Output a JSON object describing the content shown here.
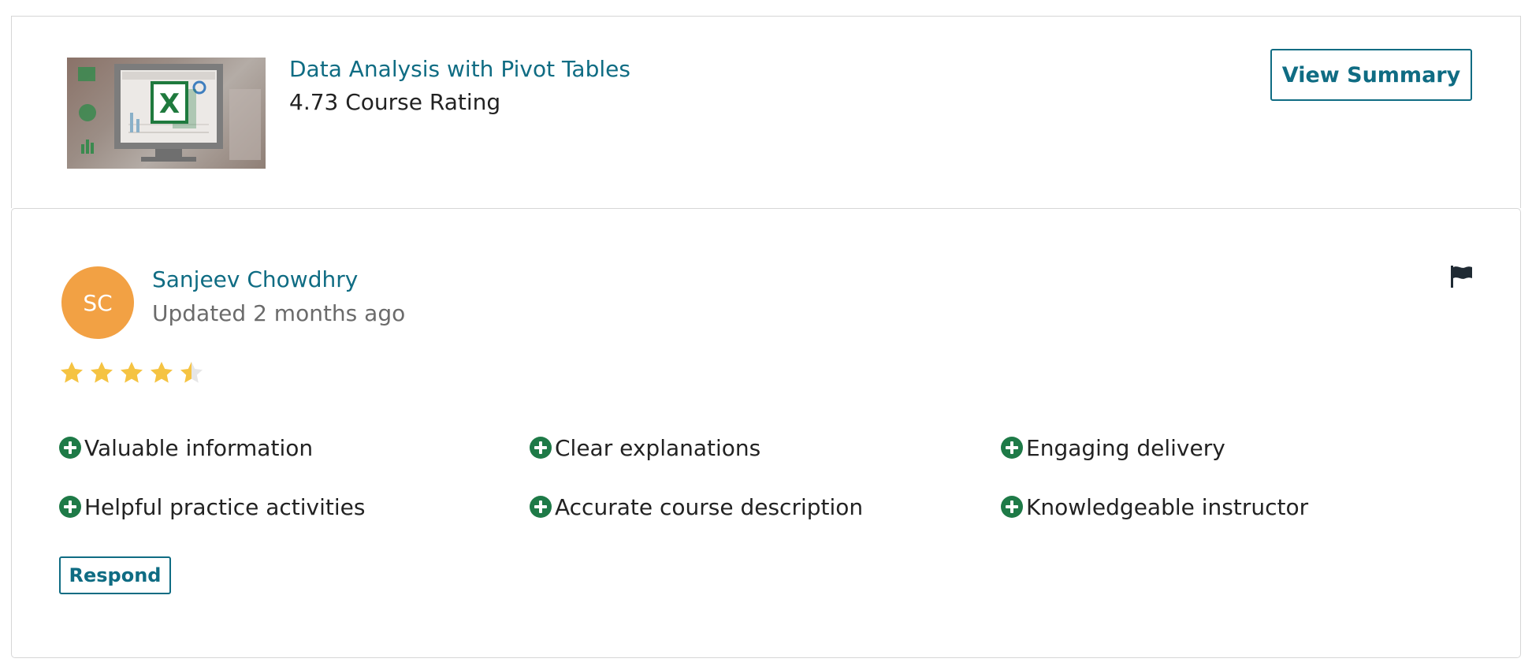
{
  "course": {
    "title": "Data Analysis with Pivot Tables",
    "rating_text": "4.73 Course Rating",
    "view_summary_label": "View Summary",
    "thumbnail_letter": "X",
    "thumbnail_icon": "excel-icon"
  },
  "review": {
    "avatar_initials": "SC",
    "reviewer_name": "Sanjeev Chowdhry",
    "updated_text": "Updated 2 months ago",
    "rating": 4.5,
    "rating_max": 5,
    "flag_icon": "flag-icon",
    "tags": [
      "Valuable information",
      "Clear explanations",
      "Engaging delivery",
      "Helpful practice activities",
      "Accurate course description",
      "Knowledgeable instructor"
    ],
    "respond_label": "Respond"
  },
  "colors": {
    "accent": "#0f6c83",
    "avatar_bg": "#f2a144",
    "tag_icon": "#1e7a47",
    "star_filled": "#f5c342",
    "star_empty": "#e6e6e6",
    "text": "#222222",
    "muted_text": "#6b6b6b"
  }
}
